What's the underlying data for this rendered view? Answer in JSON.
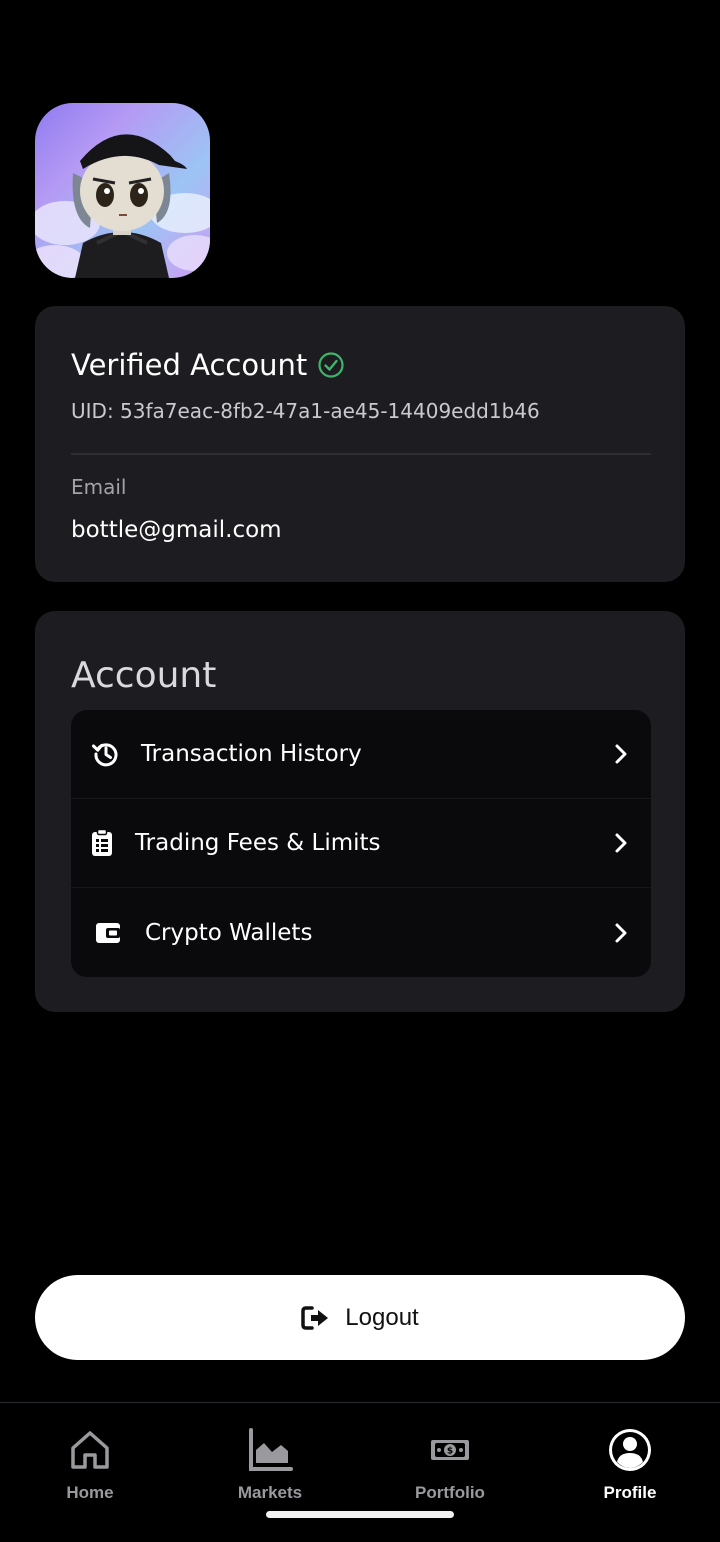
{
  "profile": {
    "avatar_icon": "user-avatar-image"
  },
  "account_card": {
    "title": "Verified Account",
    "status_icon": "check-circle-icon",
    "status_color": "#3fb46a",
    "uid": "UID: 53fa7eac-8fb2-47a1-ae45-14409edd1b46",
    "email_label": "Email",
    "email_value": "bottle@gmail.com"
  },
  "account_section": {
    "title": "Account",
    "items": [
      {
        "label": "Transaction History",
        "icon": "history-icon"
      },
      {
        "label": "Trading Fees & Limits",
        "icon": "clipboard-list-icon"
      },
      {
        "label": "Crypto Wallets",
        "icon": "wallet-icon"
      }
    ]
  },
  "logout": {
    "label": "Logout",
    "icon": "logout-icon"
  },
  "bottom_nav": {
    "items": [
      {
        "label": "Home",
        "icon": "home-icon",
        "active": false
      },
      {
        "label": "Markets",
        "icon": "area-chart-icon",
        "active": false
      },
      {
        "label": "Portfolio",
        "icon": "money-icon",
        "active": false
      },
      {
        "label": "Profile",
        "icon": "user-circle-icon",
        "active": true
      }
    ]
  },
  "colors": {
    "background": "#000000",
    "card": "#1c1c21",
    "menu_background": "#0a0a0d",
    "accent_verified": "#3fb46a",
    "nav_inactive": "#9a9a9e",
    "nav_active": "#ffffff"
  }
}
